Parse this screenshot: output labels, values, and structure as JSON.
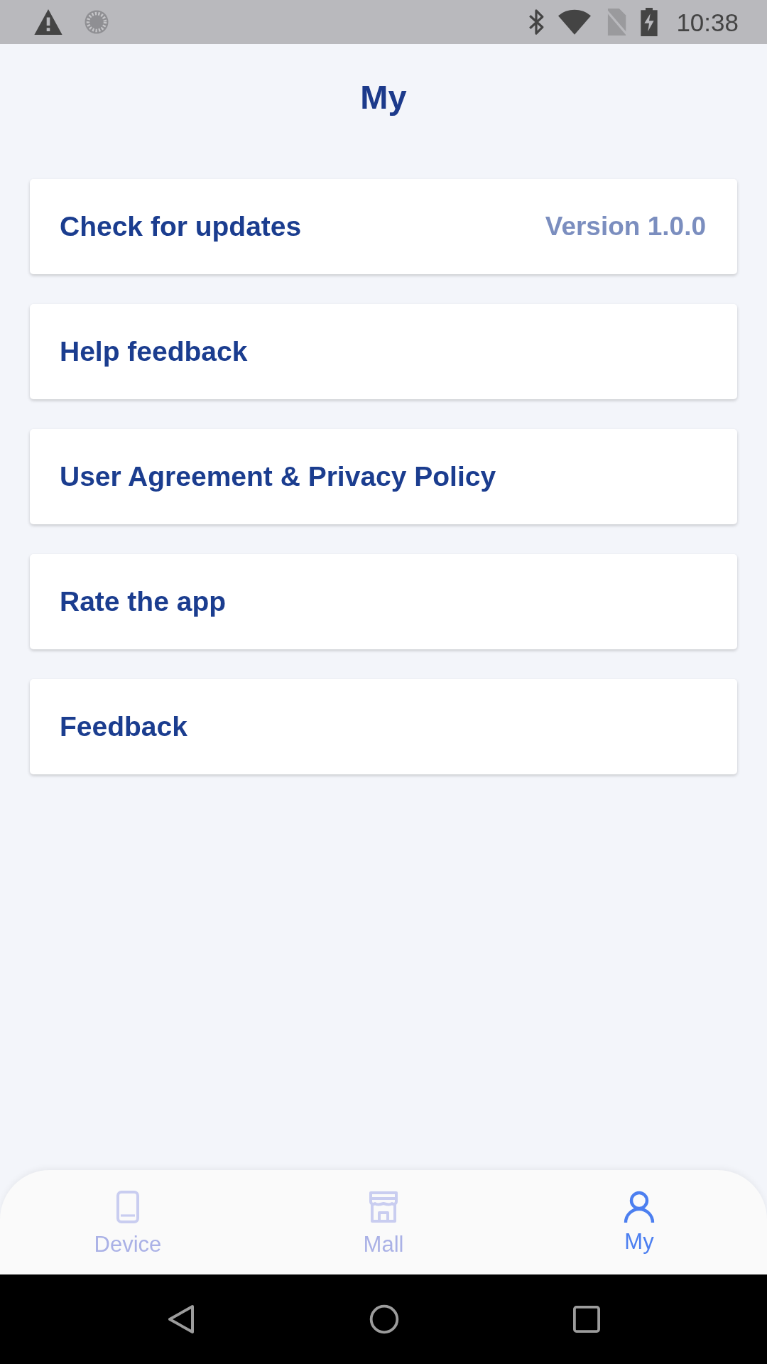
{
  "status_bar": {
    "time": "10:38"
  },
  "header": {
    "title": "My"
  },
  "menu_items": [
    {
      "label": "Check for updates",
      "value": "Version 1.0.0"
    },
    {
      "label": "Help feedback"
    },
    {
      "label": "User Agreement & Privacy Policy"
    },
    {
      "label": "Rate the app"
    },
    {
      "label": "Feedback"
    }
  ],
  "tab_bar": {
    "tabs": [
      {
        "label": "Device",
        "selected": false
      },
      {
        "label": "Mall",
        "selected": false
      },
      {
        "label": "My",
        "selected": true
      }
    ]
  }
}
